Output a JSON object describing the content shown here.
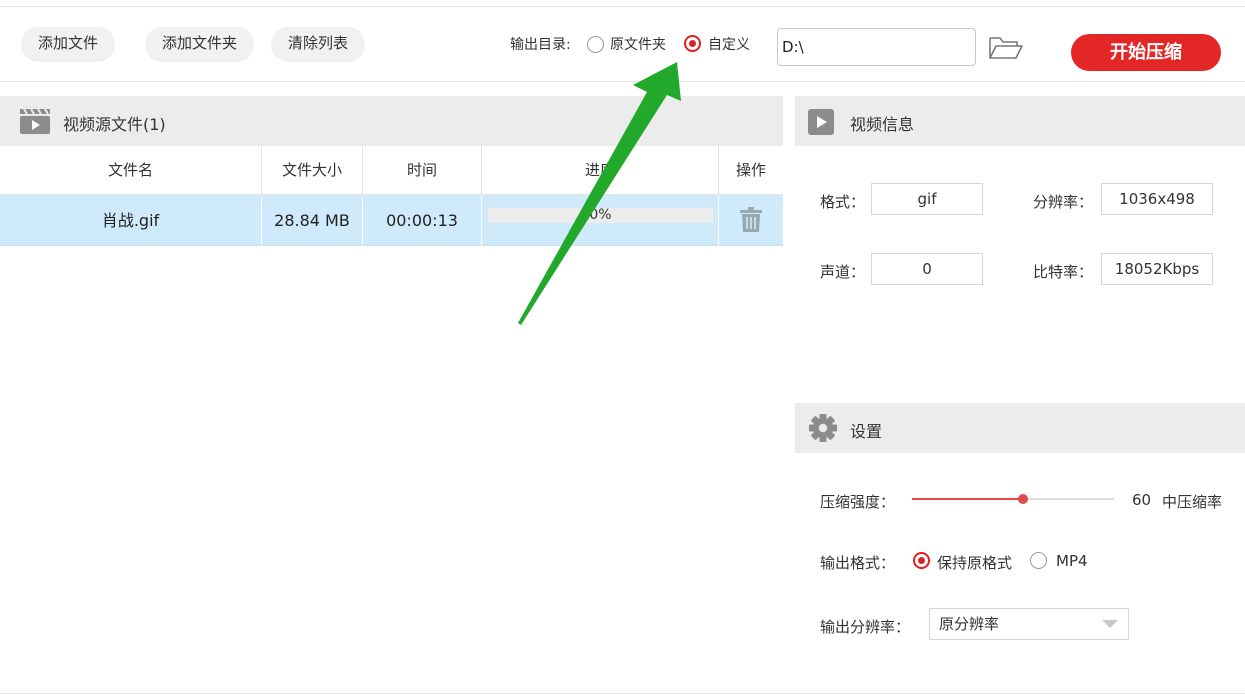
{
  "toolbar": {
    "add_file": "添加文件",
    "add_folder": "添加文件夹",
    "clear_list": "清除列表",
    "output_dir_label": "输出目录:",
    "option_original": "原文件夹",
    "option_custom": "自定义",
    "selected_option": "自定义",
    "path_value": "D:\\",
    "start_button": "开始压缩",
    "accent_color": "#e32727"
  },
  "source": {
    "title": "视频源文件(1)",
    "columns": [
      "文件名",
      "文件大小",
      "时间",
      "进度",
      "操作"
    ],
    "rows": [
      {
        "name": "肖战.gif",
        "size": "28.84 MB",
        "time": "00:00:13",
        "progress": "0%",
        "progress_value": 0
      }
    ]
  },
  "video_info": {
    "title": "视频信息",
    "format_label": "格式：",
    "format_value": "gif",
    "resolution_label": "分辨率：",
    "resolution_value": "1036x498",
    "channel_label": "声道：",
    "channel_value": "0",
    "bitrate_label": "比特率：",
    "bitrate_value": "18052Kbps"
  },
  "settings": {
    "title": "设置",
    "strength_label": "压缩强度：",
    "strength_value": "60",
    "strength_text": "中压缩率",
    "strength_fraction": 0.55,
    "format_label": "输出格式：",
    "format_keep": "保持原格式",
    "format_mp4": "MP4",
    "format_selected": "保持原格式",
    "resolution_label": "输出分辨率：",
    "resolution_selected": "原分辨率"
  },
  "annotation": {
    "arrow_color": "#22a82a"
  }
}
